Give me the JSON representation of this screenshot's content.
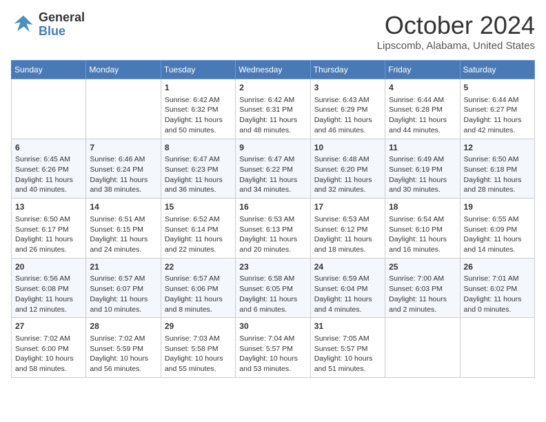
{
  "header": {
    "logo_line1": "General",
    "logo_line2": "Blue",
    "month": "October 2024",
    "location": "Lipscomb, Alabama, United States"
  },
  "days_of_week": [
    "Sunday",
    "Monday",
    "Tuesday",
    "Wednesday",
    "Thursday",
    "Friday",
    "Saturday"
  ],
  "weeks": [
    [
      {
        "day": "",
        "content": ""
      },
      {
        "day": "",
        "content": ""
      },
      {
        "day": "1",
        "content": "Sunrise: 6:42 AM\nSunset: 6:32 PM\nDaylight: 11 hours and 50 minutes."
      },
      {
        "day": "2",
        "content": "Sunrise: 6:42 AM\nSunset: 6:31 PM\nDaylight: 11 hours and 48 minutes."
      },
      {
        "day": "3",
        "content": "Sunrise: 6:43 AM\nSunset: 6:29 PM\nDaylight: 11 hours and 46 minutes."
      },
      {
        "day": "4",
        "content": "Sunrise: 6:44 AM\nSunset: 6:28 PM\nDaylight: 11 hours and 44 minutes."
      },
      {
        "day": "5",
        "content": "Sunrise: 6:44 AM\nSunset: 6:27 PM\nDaylight: 11 hours and 42 minutes."
      }
    ],
    [
      {
        "day": "6",
        "content": "Sunrise: 6:45 AM\nSunset: 6:26 PM\nDaylight: 11 hours and 40 minutes."
      },
      {
        "day": "7",
        "content": "Sunrise: 6:46 AM\nSunset: 6:24 PM\nDaylight: 11 hours and 38 minutes."
      },
      {
        "day": "8",
        "content": "Sunrise: 6:47 AM\nSunset: 6:23 PM\nDaylight: 11 hours and 36 minutes."
      },
      {
        "day": "9",
        "content": "Sunrise: 6:47 AM\nSunset: 6:22 PM\nDaylight: 11 hours and 34 minutes."
      },
      {
        "day": "10",
        "content": "Sunrise: 6:48 AM\nSunset: 6:20 PM\nDaylight: 11 hours and 32 minutes."
      },
      {
        "day": "11",
        "content": "Sunrise: 6:49 AM\nSunset: 6:19 PM\nDaylight: 11 hours and 30 minutes."
      },
      {
        "day": "12",
        "content": "Sunrise: 6:50 AM\nSunset: 6:18 PM\nDaylight: 11 hours and 28 minutes."
      }
    ],
    [
      {
        "day": "13",
        "content": "Sunrise: 6:50 AM\nSunset: 6:17 PM\nDaylight: 11 hours and 26 minutes."
      },
      {
        "day": "14",
        "content": "Sunrise: 6:51 AM\nSunset: 6:15 PM\nDaylight: 11 hours and 24 minutes."
      },
      {
        "day": "15",
        "content": "Sunrise: 6:52 AM\nSunset: 6:14 PM\nDaylight: 11 hours and 22 minutes."
      },
      {
        "day": "16",
        "content": "Sunrise: 6:53 AM\nSunset: 6:13 PM\nDaylight: 11 hours and 20 minutes."
      },
      {
        "day": "17",
        "content": "Sunrise: 6:53 AM\nSunset: 6:12 PM\nDaylight: 11 hours and 18 minutes."
      },
      {
        "day": "18",
        "content": "Sunrise: 6:54 AM\nSunset: 6:10 PM\nDaylight: 11 hours and 16 minutes."
      },
      {
        "day": "19",
        "content": "Sunrise: 6:55 AM\nSunset: 6:09 PM\nDaylight: 11 hours and 14 minutes."
      }
    ],
    [
      {
        "day": "20",
        "content": "Sunrise: 6:56 AM\nSunset: 6:08 PM\nDaylight: 11 hours and 12 minutes."
      },
      {
        "day": "21",
        "content": "Sunrise: 6:57 AM\nSunset: 6:07 PM\nDaylight: 11 hours and 10 minutes."
      },
      {
        "day": "22",
        "content": "Sunrise: 6:57 AM\nSunset: 6:06 PM\nDaylight: 11 hours and 8 minutes."
      },
      {
        "day": "23",
        "content": "Sunrise: 6:58 AM\nSunset: 6:05 PM\nDaylight: 11 hours and 6 minutes."
      },
      {
        "day": "24",
        "content": "Sunrise: 6:59 AM\nSunset: 6:04 PM\nDaylight: 11 hours and 4 minutes."
      },
      {
        "day": "25",
        "content": "Sunrise: 7:00 AM\nSunset: 6:03 PM\nDaylight: 11 hours and 2 minutes."
      },
      {
        "day": "26",
        "content": "Sunrise: 7:01 AM\nSunset: 6:02 PM\nDaylight: 11 hours and 0 minutes."
      }
    ],
    [
      {
        "day": "27",
        "content": "Sunrise: 7:02 AM\nSunset: 6:00 PM\nDaylight: 10 hours and 58 minutes."
      },
      {
        "day": "28",
        "content": "Sunrise: 7:02 AM\nSunset: 5:59 PM\nDaylight: 10 hours and 56 minutes."
      },
      {
        "day": "29",
        "content": "Sunrise: 7:03 AM\nSunset: 5:58 PM\nDaylight: 10 hours and 55 minutes."
      },
      {
        "day": "30",
        "content": "Sunrise: 7:04 AM\nSunset: 5:57 PM\nDaylight: 10 hours and 53 minutes."
      },
      {
        "day": "31",
        "content": "Sunrise: 7:05 AM\nSunset: 5:57 PM\nDaylight: 10 hours and 51 minutes."
      },
      {
        "day": "",
        "content": ""
      },
      {
        "day": "",
        "content": ""
      }
    ]
  ]
}
